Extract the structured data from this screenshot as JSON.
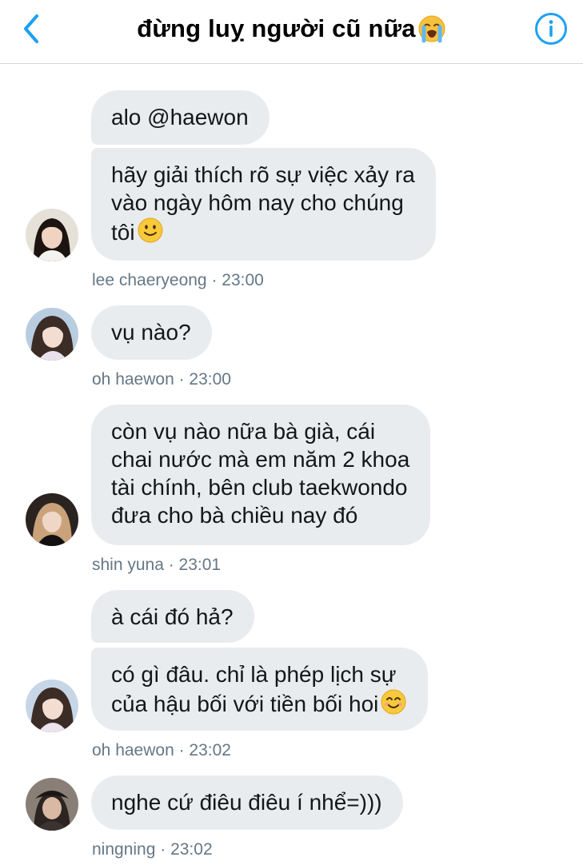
{
  "header": {
    "title": "đừng luỵ người cũ nữa",
    "title_emoji": "loudly-crying-face",
    "back_icon": "chevron-left-icon",
    "info_icon": "info-circle-icon",
    "accent_color": "#1da1f2"
  },
  "messages": [
    {
      "sender": "lee chaeryeong",
      "time": "23:00",
      "bubbles": [
        {
          "text": "alo @haewon"
        },
        {
          "text": "hãy giải thích rõ sự việc xảy ra\nvào ngày hôm nay cho chúng\ntôi",
          "emoji": "slightly-smiling-face"
        }
      ],
      "meta": "lee chaeryeong · 23:00"
    },
    {
      "sender": "oh haewon",
      "time": "23:00",
      "bubbles": [
        {
          "text": "vụ nào?"
        }
      ],
      "meta": "oh haewon · 23:00"
    },
    {
      "sender": "shin yuna",
      "time": "23:01",
      "bubbles": [
        {
          "text": "còn vụ nào nữa bà già, cái\nchai nước mà em năm 2 khoa\ntài chính, bên club taekwondo\nđưa cho bà chiều nay đó"
        }
      ],
      "meta": "shin yuna · 23:01"
    },
    {
      "sender": "oh haewon",
      "time": "23:02",
      "bubbles": [
        {
          "text": "à cái đó hả?"
        },
        {
          "text": "có gì đâu. chỉ là phép lịch sự\ncủa hậu bối với tiền bối hoi",
          "emoji": "smiling-face-with-smiling-eyes"
        }
      ],
      "meta": "oh haewon · 23:02"
    },
    {
      "sender": "ningning",
      "time": "23:02",
      "bubbles": [
        {
          "text": "nghe cứ điêu điêu í nhể=)))"
        }
      ],
      "meta": "ningning · 23:02"
    }
  ],
  "colors": {
    "bubble_bg": "#e9ecef",
    "meta_text": "#657786",
    "divider": "#d4d6d9"
  }
}
